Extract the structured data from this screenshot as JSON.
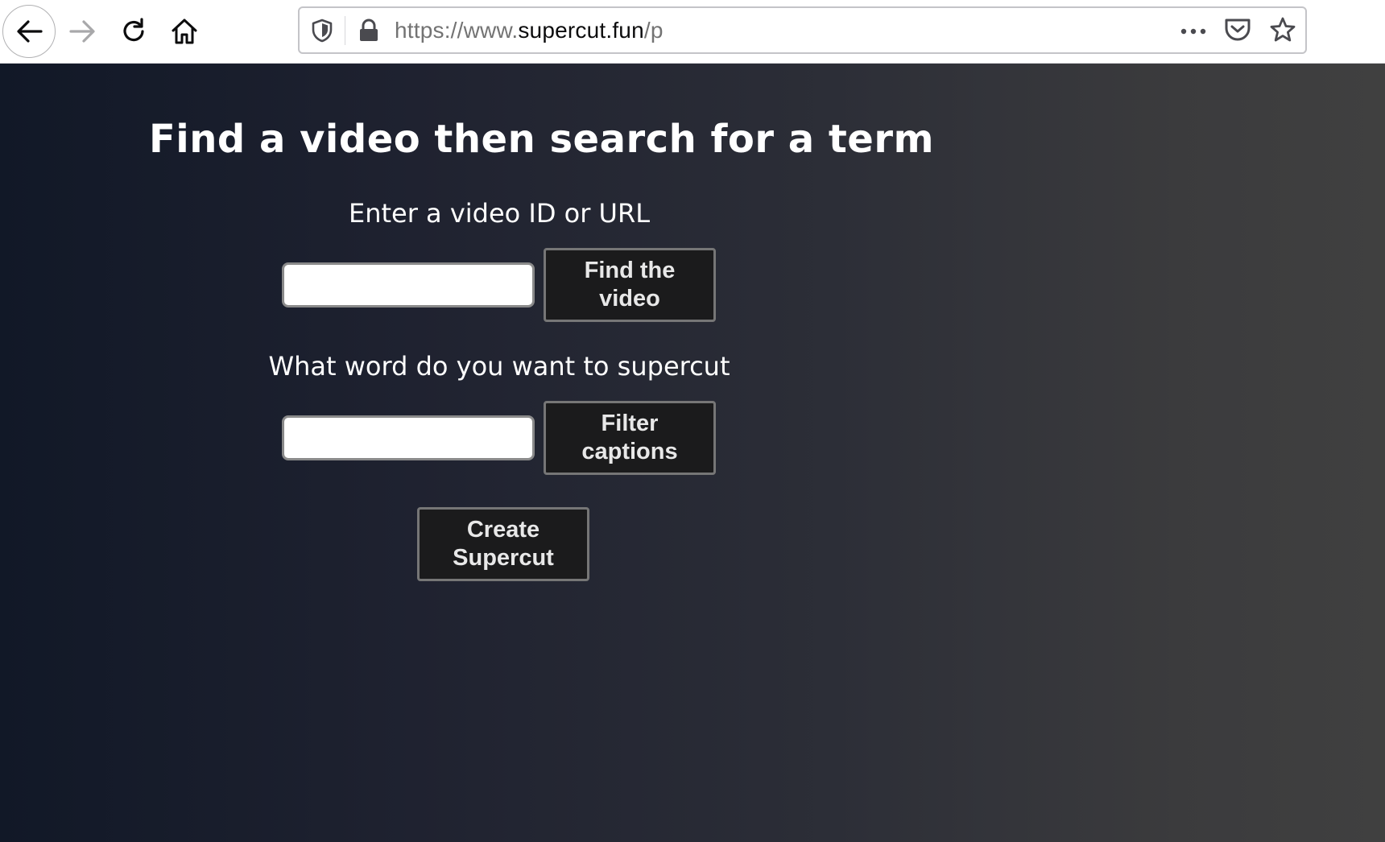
{
  "browser": {
    "url_scheme": "https://www.",
    "url_host": "supercut.fun",
    "url_path": "/p"
  },
  "page": {
    "title": "Find a video then search for a term",
    "video_section": {
      "label": "Enter a video ID or URL",
      "input_value": "",
      "button_line1": "Find the",
      "button_line2": "video"
    },
    "word_section": {
      "label": "What word do you want to supercut",
      "input_value": "",
      "button_line1": "Filter",
      "button_line2": "captions"
    },
    "create_button_line1": "Create",
    "create_button_line2": "Supercut"
  },
  "colors": {
    "page_gradient_start": "#111827",
    "page_gradient_end": "#404040",
    "button_bg": "#1b1b1c",
    "button_text": "#e8e8e8"
  }
}
